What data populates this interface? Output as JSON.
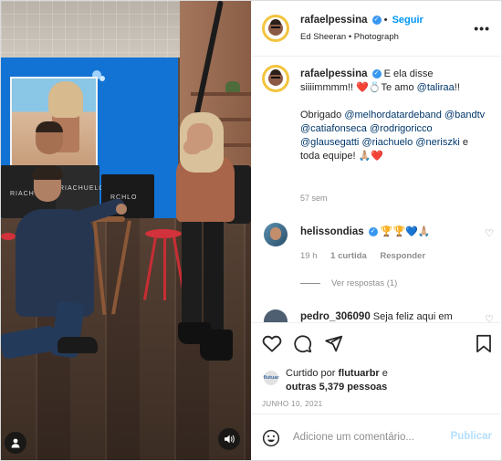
{
  "post": {
    "author": "rafaelpessina",
    "follow_label": "Seguir",
    "subtitle": "Ed Sheeran • Photograph",
    "more_label": "•••"
  },
  "media": {
    "bag_labels": [
      "RIACH",
      "RIACHUELO",
      "RCHLO"
    ]
  },
  "caption": {
    "username": "rafaelpessina",
    "text_1": "E ela disse siiiimmmm!! ",
    "emoji_heart": "❤️",
    "emoji_ring": "💍",
    "text_2": "Te amo ",
    "mention_1": "@taliraa",
    "text_3": "!!",
    "thanks": "Obrigado ",
    "mentions": [
      "@melhordatardeband",
      "@bandtv",
      "@catiafonseca",
      "@rodrigoricco",
      "@glausegatti",
      "@riachuelo",
      "@neriszki"
    ],
    "ending": "e toda equipe!",
    "ending_emojis": "🙏🏼❤️",
    "time": "57 sem"
  },
  "comments": [
    {
      "username": "helissondias",
      "text": "🏆🏆💙🙏🏼",
      "time": "19 h",
      "likes": "1 curtida",
      "reply_label": "Responder",
      "view_replies": "Ver respostas (1)"
    },
    {
      "username": "pedro_306090",
      "text": "Seja feliz aqui em"
    }
  ],
  "engagement": {
    "liked_by_prefix": "Curtido por ",
    "liked_by_user": "flutuarbr",
    "liked_by_suffix": " e",
    "others": "outras 5,379 pessoas",
    "date": "JUNHO 10, 2021",
    "mini_avatar_text": "flutuar"
  },
  "add_comment": {
    "placeholder": "Adicione um comentário...",
    "publish_label": "Publicar"
  },
  "colors": {
    "accent": "#0095f6",
    "verified": "#3897f0",
    "link": "#00376b",
    "muted": "#8e8e8e"
  },
  "icons": [
    "user-tag-icon",
    "sound-icon",
    "verified-icon",
    "heart-icon",
    "comment-icon",
    "share-icon",
    "bookmark-icon",
    "emoji-icon",
    "more-icon"
  ]
}
